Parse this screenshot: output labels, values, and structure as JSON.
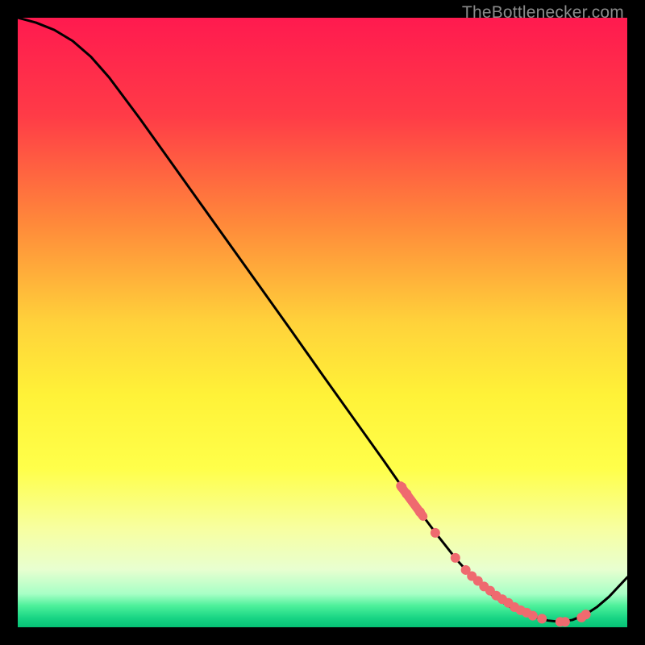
{
  "watermark": "TheBottlenecker.com",
  "chart_data": {
    "type": "line",
    "title": "",
    "xlabel": "",
    "ylabel": "",
    "xlim": [
      0,
      100
    ],
    "ylim": [
      0,
      100
    ],
    "grid": false,
    "legend": false,
    "background_gradient": {
      "stops": [
        {
          "pos": 0.0,
          "color": "#ff1a4f"
        },
        {
          "pos": 0.16,
          "color": "#ff3b47"
        },
        {
          "pos": 0.34,
          "color": "#ff8a3a"
        },
        {
          "pos": 0.5,
          "color": "#ffd23a"
        },
        {
          "pos": 0.62,
          "color": "#fff238"
        },
        {
          "pos": 0.74,
          "color": "#ffff4a"
        },
        {
          "pos": 0.84,
          "color": "#f7ffa2"
        },
        {
          "pos": 0.905,
          "color": "#e8ffd0"
        },
        {
          "pos": 0.945,
          "color": "#a8ffc6"
        },
        {
          "pos": 0.965,
          "color": "#4cf09a"
        },
        {
          "pos": 0.985,
          "color": "#18d484"
        },
        {
          "pos": 1.0,
          "color": "#06c275"
        }
      ]
    },
    "series": [
      {
        "name": "curve",
        "stroke": "#000000",
        "x": [
          0,
          3,
          6,
          9,
          12,
          15,
          20,
          25,
          30,
          35,
          40,
          45,
          50,
          55,
          60,
          63,
          66,
          69,
          72,
          75,
          78,
          81,
          84,
          87,
          89,
          91,
          93,
          95,
          97,
          100
        ],
        "y": [
          100,
          99.2,
          98.0,
          96.2,
          93.6,
          90.2,
          83.5,
          76.5,
          69.5,
          62.5,
          55.5,
          48.5,
          41.4,
          34.4,
          27.4,
          23.1,
          18.9,
          14.9,
          11.1,
          7.8,
          5.1,
          3.2,
          1.9,
          1.1,
          0.9,
          1.2,
          2.0,
          3.3,
          5.0,
          8.2
        ]
      },
      {
        "name": "dots",
        "type": "scatter",
        "color": "#ef6a6f",
        "radius": 6,
        "x": [
          63.0,
          63.8,
          66.0,
          68.5,
          71.8,
          73.5,
          74.5,
          75.5,
          76.5,
          77.5,
          78.5,
          79.5,
          80.5,
          81.5,
          82.5,
          83.5,
          84.5,
          86.0,
          89.0,
          89.8,
          92.5,
          93.2
        ],
        "y": [
          23.0,
          21.9,
          18.9,
          15.5,
          11.4,
          9.4,
          8.4,
          7.6,
          6.7,
          6.0,
          5.2,
          4.6,
          4.0,
          3.3,
          2.8,
          2.4,
          1.9,
          1.4,
          0.9,
          0.9,
          1.6,
          2.1
        ]
      }
    ],
    "thick_band": {
      "name": "low-band",
      "stroke": "#ef6a6f",
      "width": 11,
      "x": [
        62.8,
        66.5
      ],
      "y": [
        23.2,
        18.2
      ]
    }
  }
}
